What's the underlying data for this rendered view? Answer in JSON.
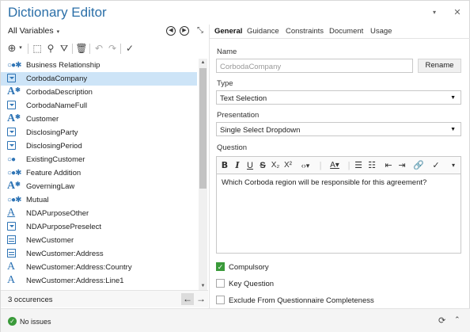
{
  "window": {
    "title": "Dictionary Editor",
    "menu_icon": "chevron-down-icon",
    "close_icon": "close-icon"
  },
  "left": {
    "selector_label": "All Variables",
    "list": [
      {
        "label": "Business Relationship",
        "icon": "dots-star"
      },
      {
        "label": "CorbodaCompany",
        "icon": "dropdown",
        "selected": true
      },
      {
        "label": "CorbodaDescription",
        "icon": "text-star"
      },
      {
        "label": "CorbodaNameFull",
        "icon": "dropdown"
      },
      {
        "label": "Customer",
        "icon": "text-star"
      },
      {
        "label": "DisclosingParty",
        "icon": "dropdown"
      },
      {
        "label": "DisclosingPeriod",
        "icon": "dropdown"
      },
      {
        "label": "ExistingCustomer",
        "icon": "dots"
      },
      {
        "label": "Feature Addition",
        "icon": "dots-star"
      },
      {
        "label": "GoverningLaw",
        "icon": "text-star"
      },
      {
        "label": "Mutual",
        "icon": "dots-star"
      },
      {
        "label": "NDAPurposeOther",
        "icon": "text-under"
      },
      {
        "label": "NDAPurposePreselect",
        "icon": "dropdown"
      },
      {
        "label": "NewCustomer",
        "icon": "grid"
      },
      {
        "label": "NewCustomer:Address",
        "icon": "grid"
      },
      {
        "label": "NewCustomer:Address:Country",
        "icon": "text"
      },
      {
        "label": "NewCustomer:Address:Line1",
        "icon": "text"
      }
    ],
    "occurrences": "3 occurences"
  },
  "tabs": [
    "General",
    "Guidance",
    "Constraints",
    "Document",
    "Usage"
  ],
  "general": {
    "name_label": "Name",
    "name_value": "CorbodaCompany",
    "rename_button": "Rename",
    "type_label": "Type",
    "type_value": "Text Selection",
    "presentation_label": "Presentation",
    "presentation_value": "Single Select Dropdown",
    "question_label": "Question",
    "question_text": "Which Corboda region will be responsible for this agreement?",
    "checkboxes": [
      {
        "label": "Compulsory",
        "checked": true
      },
      {
        "label": "Key Question",
        "checked": false
      },
      {
        "label": "Exclude From Questionnaire Completeness",
        "checked": false
      }
    ]
  },
  "status": {
    "text": "No issues"
  },
  "colors": {
    "accent": "#2e74b5",
    "title": "#2b6fa8",
    "ok": "#3a9a3a",
    "selection": "#cde4f7"
  }
}
